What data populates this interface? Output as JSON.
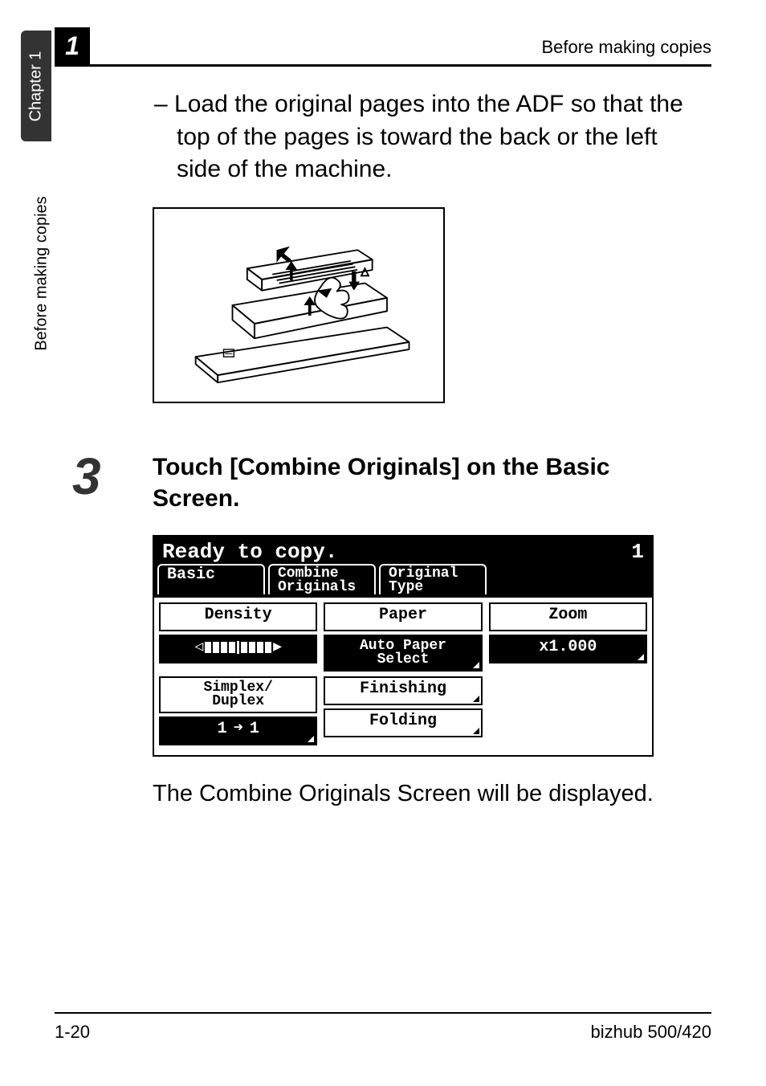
{
  "sidebar": {
    "chapter_tab": "Chapter 1",
    "section_label": "Before making copies"
  },
  "header": {
    "chapter_number": "1",
    "running_title": "Before making copies"
  },
  "body": {
    "bullet_prefix": "– ",
    "bullet_text": "Load the original pages into the ADF so that the top of the pages is toward the back or the left side of the machine.",
    "figure_alt": "Illustration of loading originals into the ADF"
  },
  "step": {
    "number": "3",
    "heading": "Touch [Combine Originals] on the Basic Screen.",
    "result_text": "The Combine Originals Screen will be displayed."
  },
  "lcd": {
    "status": "Ready to copy.",
    "count": "1",
    "tabs": {
      "basic": "Basic",
      "combine_line1": "Combine",
      "combine_line2": "Originals",
      "orig_line1": "Original",
      "orig_line2": "Type"
    },
    "col1": {
      "density_label": "Density",
      "simplex_label_line1": "Simplex/",
      "simplex_label_line2": "Duplex",
      "simplex_value_left": "1",
      "simplex_value_arrow": "➜",
      "simplex_value_right": "1"
    },
    "col2": {
      "paper_label": "Paper",
      "paper_value_line1": "Auto Paper",
      "paper_value_line2": "Select",
      "finishing": "Finishing",
      "folding": "Folding"
    },
    "col3": {
      "zoom_label": "Zoom",
      "zoom_value": "x1.000"
    }
  },
  "footer": {
    "page_num": "1-20",
    "model": "bizhub 500/420"
  }
}
